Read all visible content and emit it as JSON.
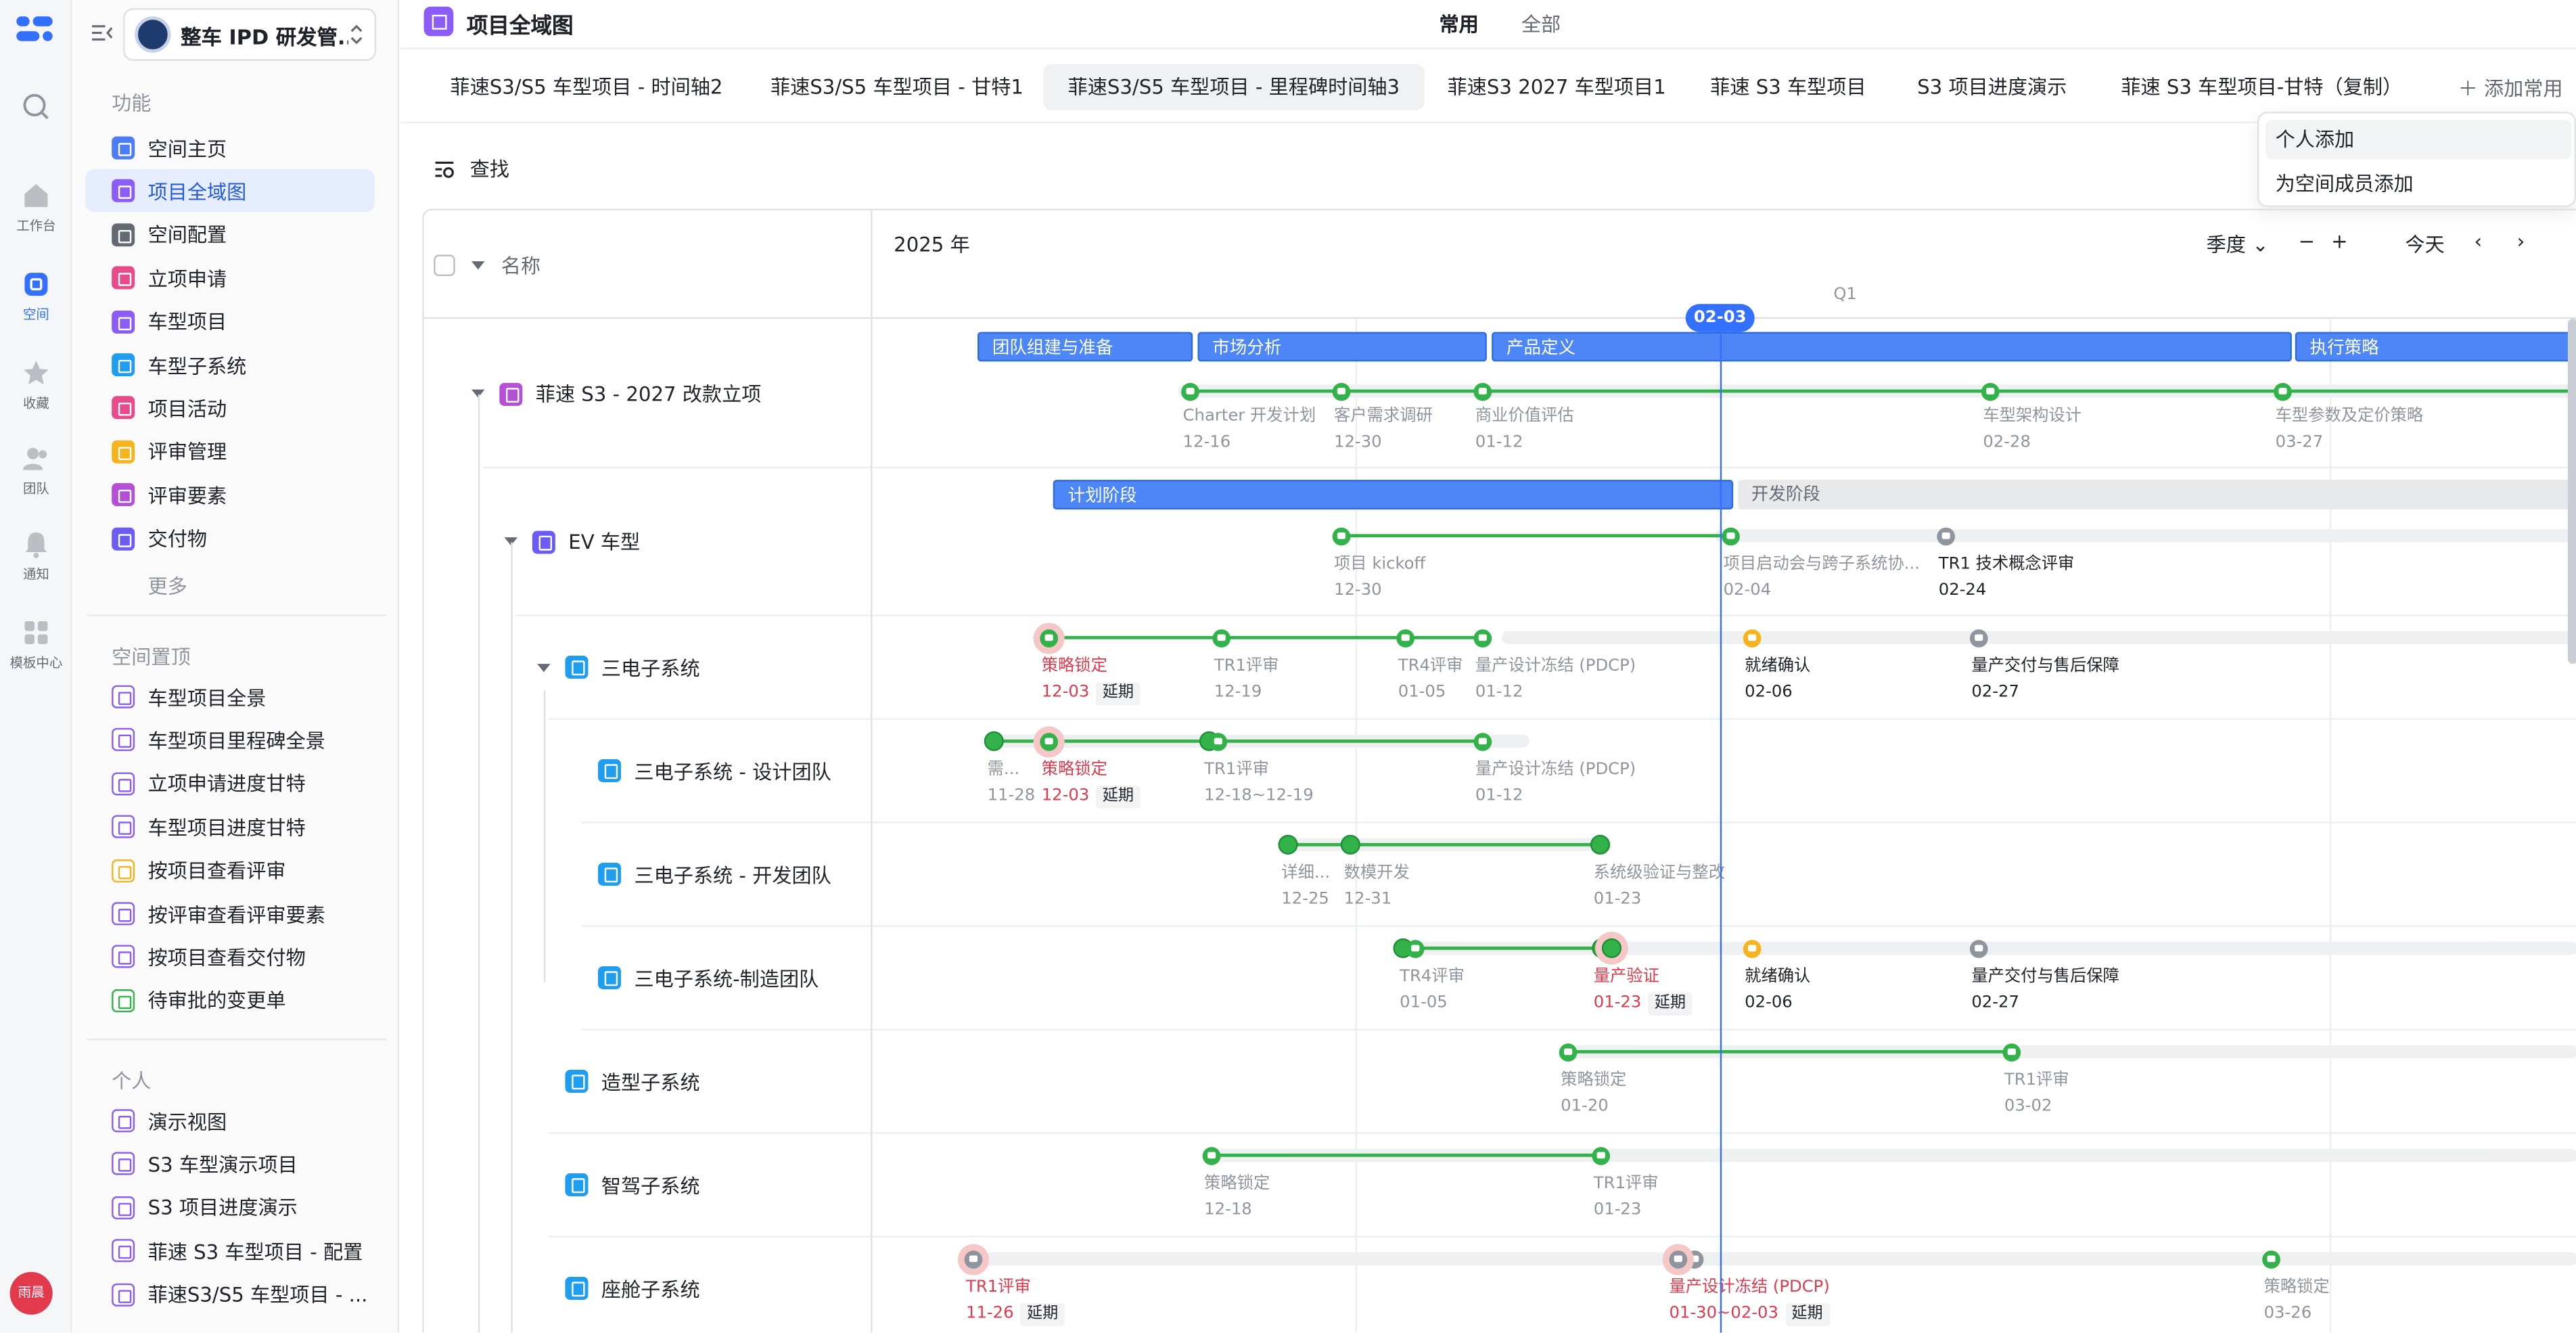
{
  "rail": {
    "items": [
      {
        "label": "",
        "icon": "search-icon"
      },
      {
        "label": "工作台",
        "icon": "home-icon"
      },
      {
        "label": "空间",
        "icon": "space-icon"
      },
      {
        "label": "收藏",
        "icon": "star-icon"
      },
      {
        "label": "团队",
        "icon": "team-icon"
      },
      {
        "label": "通知",
        "icon": "bell-icon"
      },
      {
        "label": "模板中心",
        "icon": "template-icon"
      }
    ],
    "avatar": "雨晨"
  },
  "sidebar": {
    "space_name": "整车 IPD 研发管...",
    "function_title": "功能",
    "functions": [
      {
        "label": "空间主页",
        "color": "#4c7cf6"
      },
      {
        "label": "项目全域图",
        "color": "#8b5cf6"
      },
      {
        "label": "空间配置",
        "color": "#646a73"
      },
      {
        "label": "立项申请",
        "color": "#e84a8a"
      },
      {
        "label": "车型项目",
        "color": "#8b5cf6"
      },
      {
        "label": "车型子系统",
        "color": "#1f9ef0"
      },
      {
        "label": "项目活动",
        "color": "#e84a8a"
      },
      {
        "label": "评审管理",
        "color": "#f5b41e"
      },
      {
        "label": "评审要素",
        "color": "#b44fd6"
      },
      {
        "label": "交付物",
        "color": "#6b5cf6"
      }
    ],
    "more": "更多",
    "pinned_title": "空间置顶",
    "pinned": [
      {
        "label": "车型项目全景",
        "color": "#8b5cf6"
      },
      {
        "label": "车型项目里程碑全景",
        "color": "#8b5cf6"
      },
      {
        "label": "立项申请进度甘特",
        "color": "#8b5cf6"
      },
      {
        "label": "车型项目进度甘特",
        "color": "#8b5cf6"
      },
      {
        "label": "按项目查看评审",
        "color": "#f5b41e"
      },
      {
        "label": "按评审查看评审要素",
        "color": "#8b5cf6"
      },
      {
        "label": "按项目查看交付物",
        "color": "#8b5cf6"
      },
      {
        "label": "待审批的变更单",
        "color": "#34b24a"
      }
    ],
    "personal_title": "个人",
    "personal": [
      {
        "label": "演示视图",
        "color": "#8b5cf6"
      },
      {
        "label": "S3 车型演示项目",
        "color": "#8b5cf6"
      },
      {
        "label": "S3 项目进度演示",
        "color": "#8b5cf6"
      },
      {
        "label": "菲速 S3 车型项目 - 配置",
        "color": "#8b5cf6"
      },
      {
        "label": "菲速S3/S5 车型项目 - ...",
        "color": "#8b5cf6"
      }
    ]
  },
  "header": {
    "title": "项目全域图",
    "tab_common": "常用",
    "tab_all": "全部"
  },
  "view_tabs": [
    "菲速S3/S5 车型项目 - 时间轴2",
    "菲速S3/S5 车型项目 - 甘特1",
    "菲速S3/S5 车型项目 - 里程碑时间轴3",
    "菲速S3 2027 车型项目1",
    "菲速 S3 车型项目",
    "S3 项目进度演示",
    "菲速 S3 车型项目-甘特（复制）"
  ],
  "add_common": "添加常用",
  "dropdown": [
    "个人添加",
    "为空间成员添加"
  ],
  "find_label": "查找",
  "gantt": {
    "name_header": "名称",
    "year": "2025 年",
    "scale": "季度",
    "today_btn": "今天",
    "quarter": "Q1",
    "today_badge": "02-03",
    "rows": [
      {
        "name": "菲速 S3 - 2027 改款立项",
        "color": "#b44fd6"
      },
      {
        "name": "EV 车型",
        "color": "#6b5cf6"
      },
      {
        "name": "三电子系统",
        "color": "#1f9ef0"
      },
      {
        "name": "三电子系统 - 设计团队",
        "color": "#1f9ef0"
      },
      {
        "name": "三电子系统 - 开发团队",
        "color": "#1f9ef0"
      },
      {
        "name": "三电子系统-制造团队",
        "color": "#1f9ef0"
      },
      {
        "name": "造型子系统",
        "color": "#1f9ef0"
      },
      {
        "name": "智驾子系统",
        "color": "#1f9ef0"
      },
      {
        "name": "座舱子系统",
        "color": "#1f9ef0"
      }
    ],
    "phases": [
      {
        "label": "团队组建与准备"
      },
      {
        "label": "市场分析"
      },
      {
        "label": "产品定义"
      },
      {
        "label": "执行策略"
      },
      {
        "label": "计划阶段"
      },
      {
        "label": "开发阶段"
      }
    ],
    "late_tag": "延期",
    "milestones": [
      {
        "name": "Charter 开发计划",
        "date": "12-16"
      },
      {
        "name": "客户需求调研",
        "date": "12-30"
      },
      {
        "name": "商业价值评估",
        "date": "01-12"
      },
      {
        "name": "车型架构设计",
        "date": "02-28"
      },
      {
        "name": "车型参数及定价策略",
        "date": "03-27"
      },
      {
        "name": "项目 kickoff",
        "date": "12-30"
      },
      {
        "name": "项目启动会与跨子系统协...",
        "date": "02-04"
      },
      {
        "name": "TR1 技术概念评审",
        "date": "02-24"
      },
      {
        "name": "策略锁定",
        "date": "12-03"
      },
      {
        "name": "TR1评审",
        "date": "12-19"
      },
      {
        "name": "TR4评审",
        "date": "01-05"
      },
      {
        "name": "量产设计冻结 (PDCP)",
        "date": "01-12"
      },
      {
        "name": "就绪确认",
        "date": "02-06"
      },
      {
        "name": "量产交付与售后保障",
        "date": "02-27"
      },
      {
        "name": "需...",
        "date": "11-28"
      },
      {
        "name": "策略锁定",
        "date": "12-03"
      },
      {
        "name": "TR1评审",
        "date": "12-18~12-19"
      },
      {
        "name": "量产设计冻结 (PDCP)",
        "date": "01-12"
      },
      {
        "name": "详细...",
        "date": "12-25"
      },
      {
        "name": "数模开发",
        "date": "12-31"
      },
      {
        "name": "系统级验证与整改",
        "date": "01-23"
      },
      {
        "name": "TR4评审",
        "date": "01-05"
      },
      {
        "name": "量产验证",
        "date": "01-23"
      },
      {
        "name": "就绪确认",
        "date": "02-06"
      },
      {
        "name": "量产交付与售后保障",
        "date": "02-27"
      },
      {
        "name": "策略锁定",
        "date": "01-20"
      },
      {
        "name": "TR1评审",
        "date": "03-02"
      },
      {
        "name": "策略锁定",
        "date": "12-18"
      },
      {
        "name": "TR1评审",
        "date": "01-23"
      },
      {
        "name": "TR1评审",
        "date": "11-26"
      },
      {
        "name": "量产设计冻结 (PDCP)",
        "date": "01-30~02-03"
      },
      {
        "name": "策略锁定",
        "date": "03-26"
      }
    ]
  }
}
